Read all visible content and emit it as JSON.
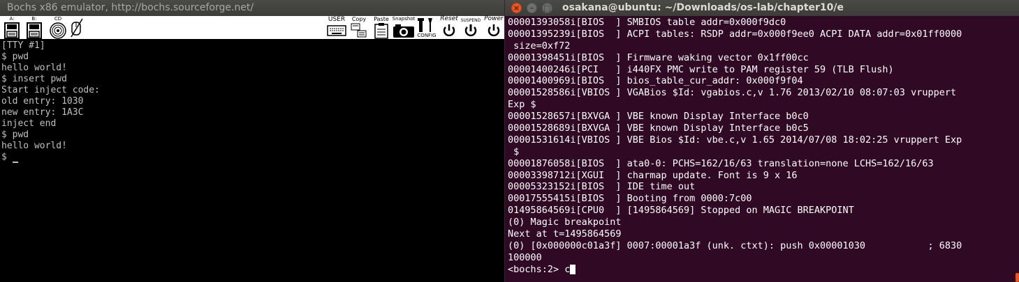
{
  "bochs": {
    "title": "Bochs x86 emulator, http://bochs.sourceforge.net/",
    "toolbar": {
      "floppy_a": "A:",
      "floppy_b": "B:",
      "cdrom": "CD",
      "user": "USER",
      "copy": "Copy",
      "paste": "Paste",
      "snapshot": "Snapshot",
      "config": "CONFIG",
      "reset": "Reset",
      "suspend": "SUSPEND",
      "power": "Power"
    },
    "tty_lines": [
      "[TTY #1]",
      "$ pwd",
      "hello world!",
      "$ insert pwd",
      "Start inject code:",
      "old entry: 1030",
      "new entry: 1A3C",
      "inject end",
      "$ pwd",
      "hello world!",
      "$ "
    ]
  },
  "terminal": {
    "title": "osakana@ubuntu: ~/Downloads/os-lab/chapter10/e",
    "lines": [
      "00001393058i[BIOS  ] SMBIOS table addr=0x000f9dc0",
      "00001395239i[BIOS  ] ACPI tables: RSDP addr=0x000f9ee0 ACPI DATA addr=0x01ff0000",
      " size=0xf72",
      "00001398451i[BIOS  ] Firmware waking vector 0x1ff00cc",
      "00001400246i[PCI   ] i440FX PMC write to PAM register 59 (TLB Flush)",
      "00001400969i[BIOS  ] bios_table_cur_addr: 0x000f9f04",
      "00001528586i[VBIOS ] VGABios $Id: vgabios.c,v 1.76 2013/02/10 08:07:03 vruppert",
      "Exp $",
      "00001528657i[BXVGA ] VBE known Display Interface b0c0",
      "00001528689i[BXVGA ] VBE known Display Interface b0c5",
      "00001531614i[VBIOS ] VBE Bios $Id: vbe.c,v 1.65 2014/07/08 18:02:25 vruppert Exp",
      " $",
      "00001876058i[BIOS  ] ata0-0: PCHS=162/16/63 translation=none LCHS=162/16/63",
      "00003398712i[XGUI  ] charmap update. Font is 9 x 16",
      "00005323152i[BIOS  ] IDE time out",
      "00017555415i[BIOS  ] Booting from 0000:7c00",
      "01495864569i[CPU0  ] [1495864569] Stopped on MAGIC BREAKPOINT",
      "(0) Magic breakpoint",
      "Next at t=1495864569",
      "(0) [0x000000c01a3f] 0007:00001a3f (unk. ctxt): push 0x00001030           ; 6830",
      "100000"
    ],
    "prompt": "<bochs:2> c",
    "colors": {
      "background": "#300a24",
      "text": "#ffffff",
      "accent": "#e95420"
    }
  }
}
